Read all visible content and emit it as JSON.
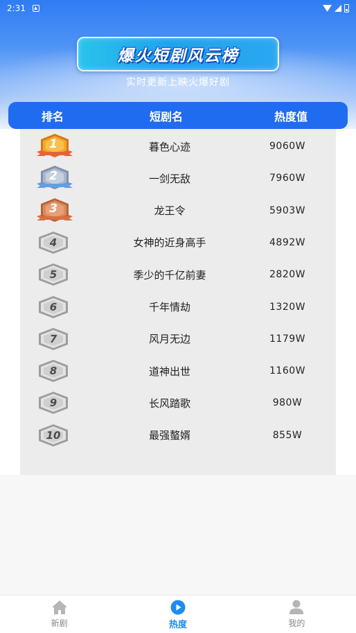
{
  "status_bar": {
    "time": "2:31"
  },
  "hero": {
    "title": "爆火短剧风云榜",
    "subtitle": "实时更新上映火爆好剧"
  },
  "table_header": {
    "rank": "排名",
    "name": "短剧名",
    "heat": "热度值"
  },
  "rows": [
    {
      "rank": "1",
      "name": "暮色心迹",
      "heat": "9060W",
      "medal": "gold"
    },
    {
      "rank": "2",
      "name": "一剑无敌",
      "heat": "7960W",
      "medal": "silver"
    },
    {
      "rank": "3",
      "name": "龙王令",
      "heat": "5903W",
      "medal": "bronze"
    },
    {
      "rank": "4",
      "name": "女神的近身高手",
      "heat": "4892W",
      "medal": "plain"
    },
    {
      "rank": "5",
      "name": "季少的千亿前妻",
      "heat": "2820W",
      "medal": "plain"
    },
    {
      "rank": "6",
      "name": "千年情劫",
      "heat": "1320W",
      "medal": "plain"
    },
    {
      "rank": "7",
      "name": "风月无边",
      "heat": "1179W",
      "medal": "plain"
    },
    {
      "rank": "8",
      "name": "道神出世",
      "heat": "1160W",
      "medal": "plain"
    },
    {
      "rank": "9",
      "name": "长风踏歌",
      "heat": "980W",
      "medal": "plain"
    },
    {
      "rank": "10",
      "name": "最强螯婿",
      "heat": "855W",
      "medal": "plain"
    }
  ],
  "tabbar": {
    "tabs": [
      {
        "label": "新剧",
        "icon": "home-icon",
        "active": false
      },
      {
        "label": "热度",
        "icon": "play-circle-icon",
        "active": true
      },
      {
        "label": "我的",
        "icon": "user-icon",
        "active": false
      }
    ]
  },
  "colors": {
    "accent": "#1f6cf0",
    "active_tab": "#1d8cf0",
    "gold": "#f2a82a",
    "silver": "#aab7cc",
    "bronze": "#d98b5a"
  }
}
